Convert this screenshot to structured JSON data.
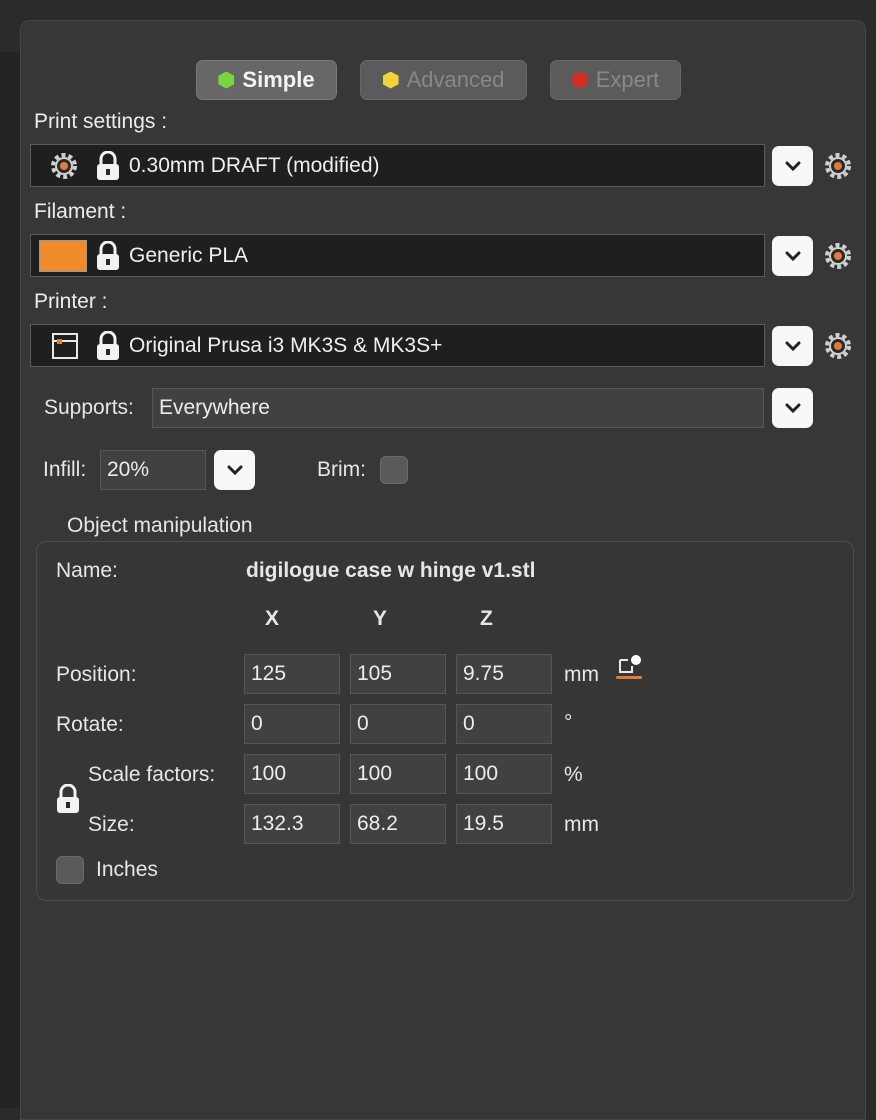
{
  "modes": [
    {
      "label": "Simple",
      "color": "#7ed43c"
    },
    {
      "label": "Advanced",
      "color": "#f2d23a"
    },
    {
      "label": "Expert",
      "color": "#d42d22"
    }
  ],
  "print_settings": {
    "label": "Print settings :",
    "value": "0.30mm DRAFT (modified)"
  },
  "filament": {
    "label": "Filament :",
    "value": "Generic PLA",
    "swatch_color": "#f08a2c"
  },
  "printer": {
    "label": "Printer :",
    "value": "Original Prusa i3 MK3S & MK3S+"
  },
  "supports": {
    "label": "Supports:",
    "value": "Everywhere"
  },
  "infill": {
    "label": "Infill:",
    "value": "20%"
  },
  "brim": {
    "label": "Brim:"
  },
  "object_manipulation": {
    "title": "Object manipulation",
    "name_label": "Name:",
    "name_value": "digilogue case w hinge v1.stl",
    "axes": [
      "X",
      "Y",
      "Z"
    ],
    "rows": [
      {
        "label": "Position:",
        "values": [
          "125",
          "105",
          "9.75"
        ],
        "unit": "mm"
      },
      {
        "label": "Rotate:",
        "values": [
          "0",
          "0",
          "0"
        ],
        "unit": "°"
      },
      {
        "label": "Scale factors:",
        "values": [
          "100",
          "100",
          "100"
        ],
        "unit": "%"
      },
      {
        "label": "Size:",
        "values": [
          "132.3",
          "68.2",
          "19.5"
        ],
        "unit": "mm"
      }
    ],
    "inches_label": "Inches"
  },
  "accent_color": "#e07b3a"
}
